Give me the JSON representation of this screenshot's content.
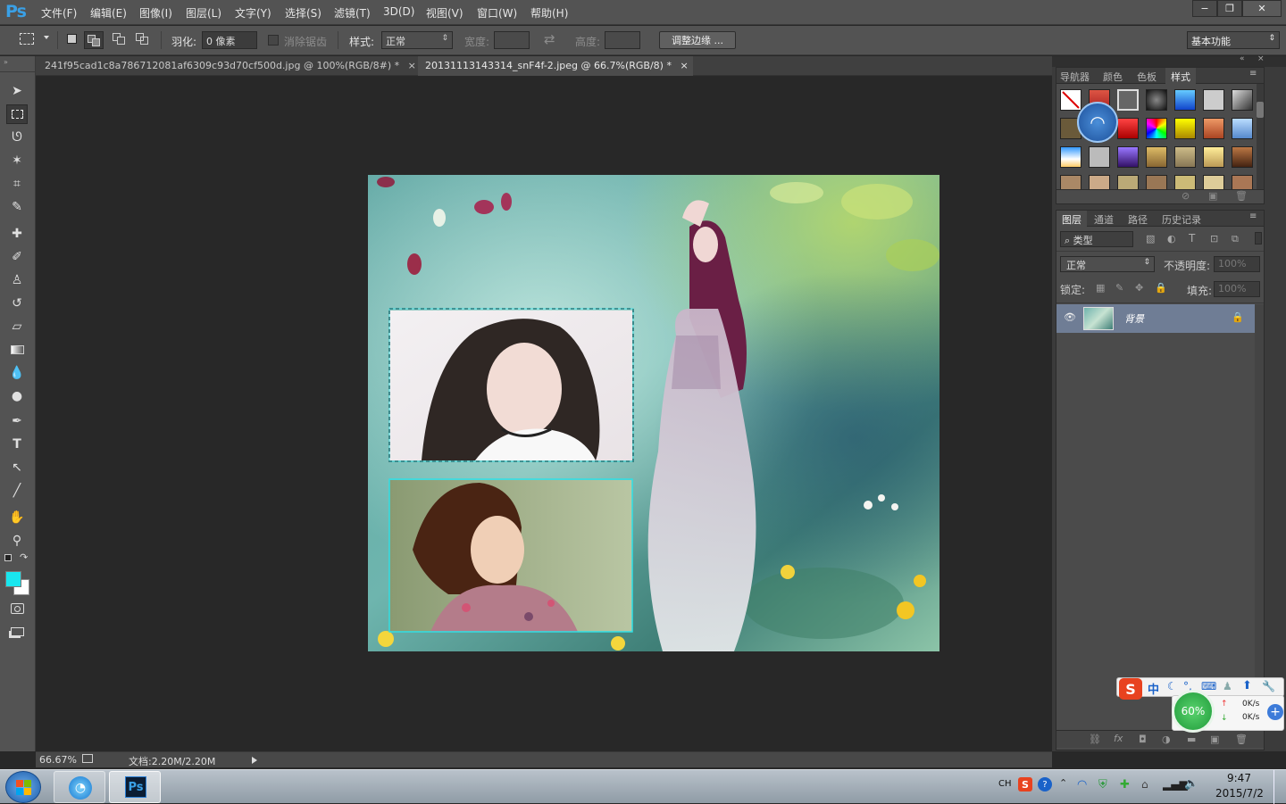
{
  "app": {
    "logo": "Ps"
  },
  "menu": [
    "文件(F)",
    "编辑(E)",
    "图像(I)",
    "图层(L)",
    "文字(Y)",
    "选择(S)",
    "滤镜(T)",
    "3D(D)",
    "视图(V)",
    "窗口(W)",
    "帮助(H)"
  ],
  "window_buttons": {
    "minimize": "−",
    "restore": "❐",
    "close": "✕"
  },
  "options": {
    "feather_label": "羽化:",
    "feather_value": "0 像素",
    "antialias_label": "消除锯齿",
    "style_label": "样式:",
    "style_value": "正常",
    "width_label": "宽度:",
    "height_label": "高度:",
    "refine_button": "调整边缘 ...",
    "workspace": "基本功能"
  },
  "tabs": [
    {
      "title": "241f95cad1c8a786712081af6309c93d70cf500d.jpg @ 100%(RGB/8#) *",
      "close": "×"
    },
    {
      "title": "20131113143314_snF4f-2.jpeg @ 66.7%(RGB/8) *",
      "close": "×"
    }
  ],
  "status": {
    "zoom": "66.67%",
    "doc": "文档:2.20M/2.20M"
  },
  "colors": {
    "foreground": "#19e6ee",
    "background": "#ffffff",
    "accent": "#3aa0e6",
    "selection": "#2fe0e6"
  },
  "panels": {
    "top_tabs": [
      "导航器",
      "颜色",
      "色板",
      "样式"
    ],
    "layer_tabs": [
      "图层",
      "通道",
      "路径",
      "历史记录"
    ],
    "filter_kind": "类型",
    "blend_mode": "正常",
    "opacity_label": "不透明度:",
    "opacity_value": "100%",
    "lock_label": "锁定:",
    "fill_label": "填充:",
    "fill_value": "100%",
    "layer_name": "背景",
    "footer_fx": "fx"
  },
  "ime": {
    "mode": "中",
    "percent": "60%",
    "up": "0K/s",
    "down": "0K/s"
  },
  "taskbar": {
    "lang": "CH",
    "time": "9:47",
    "date": "2015/7/2",
    "ps_label": "Ps"
  }
}
